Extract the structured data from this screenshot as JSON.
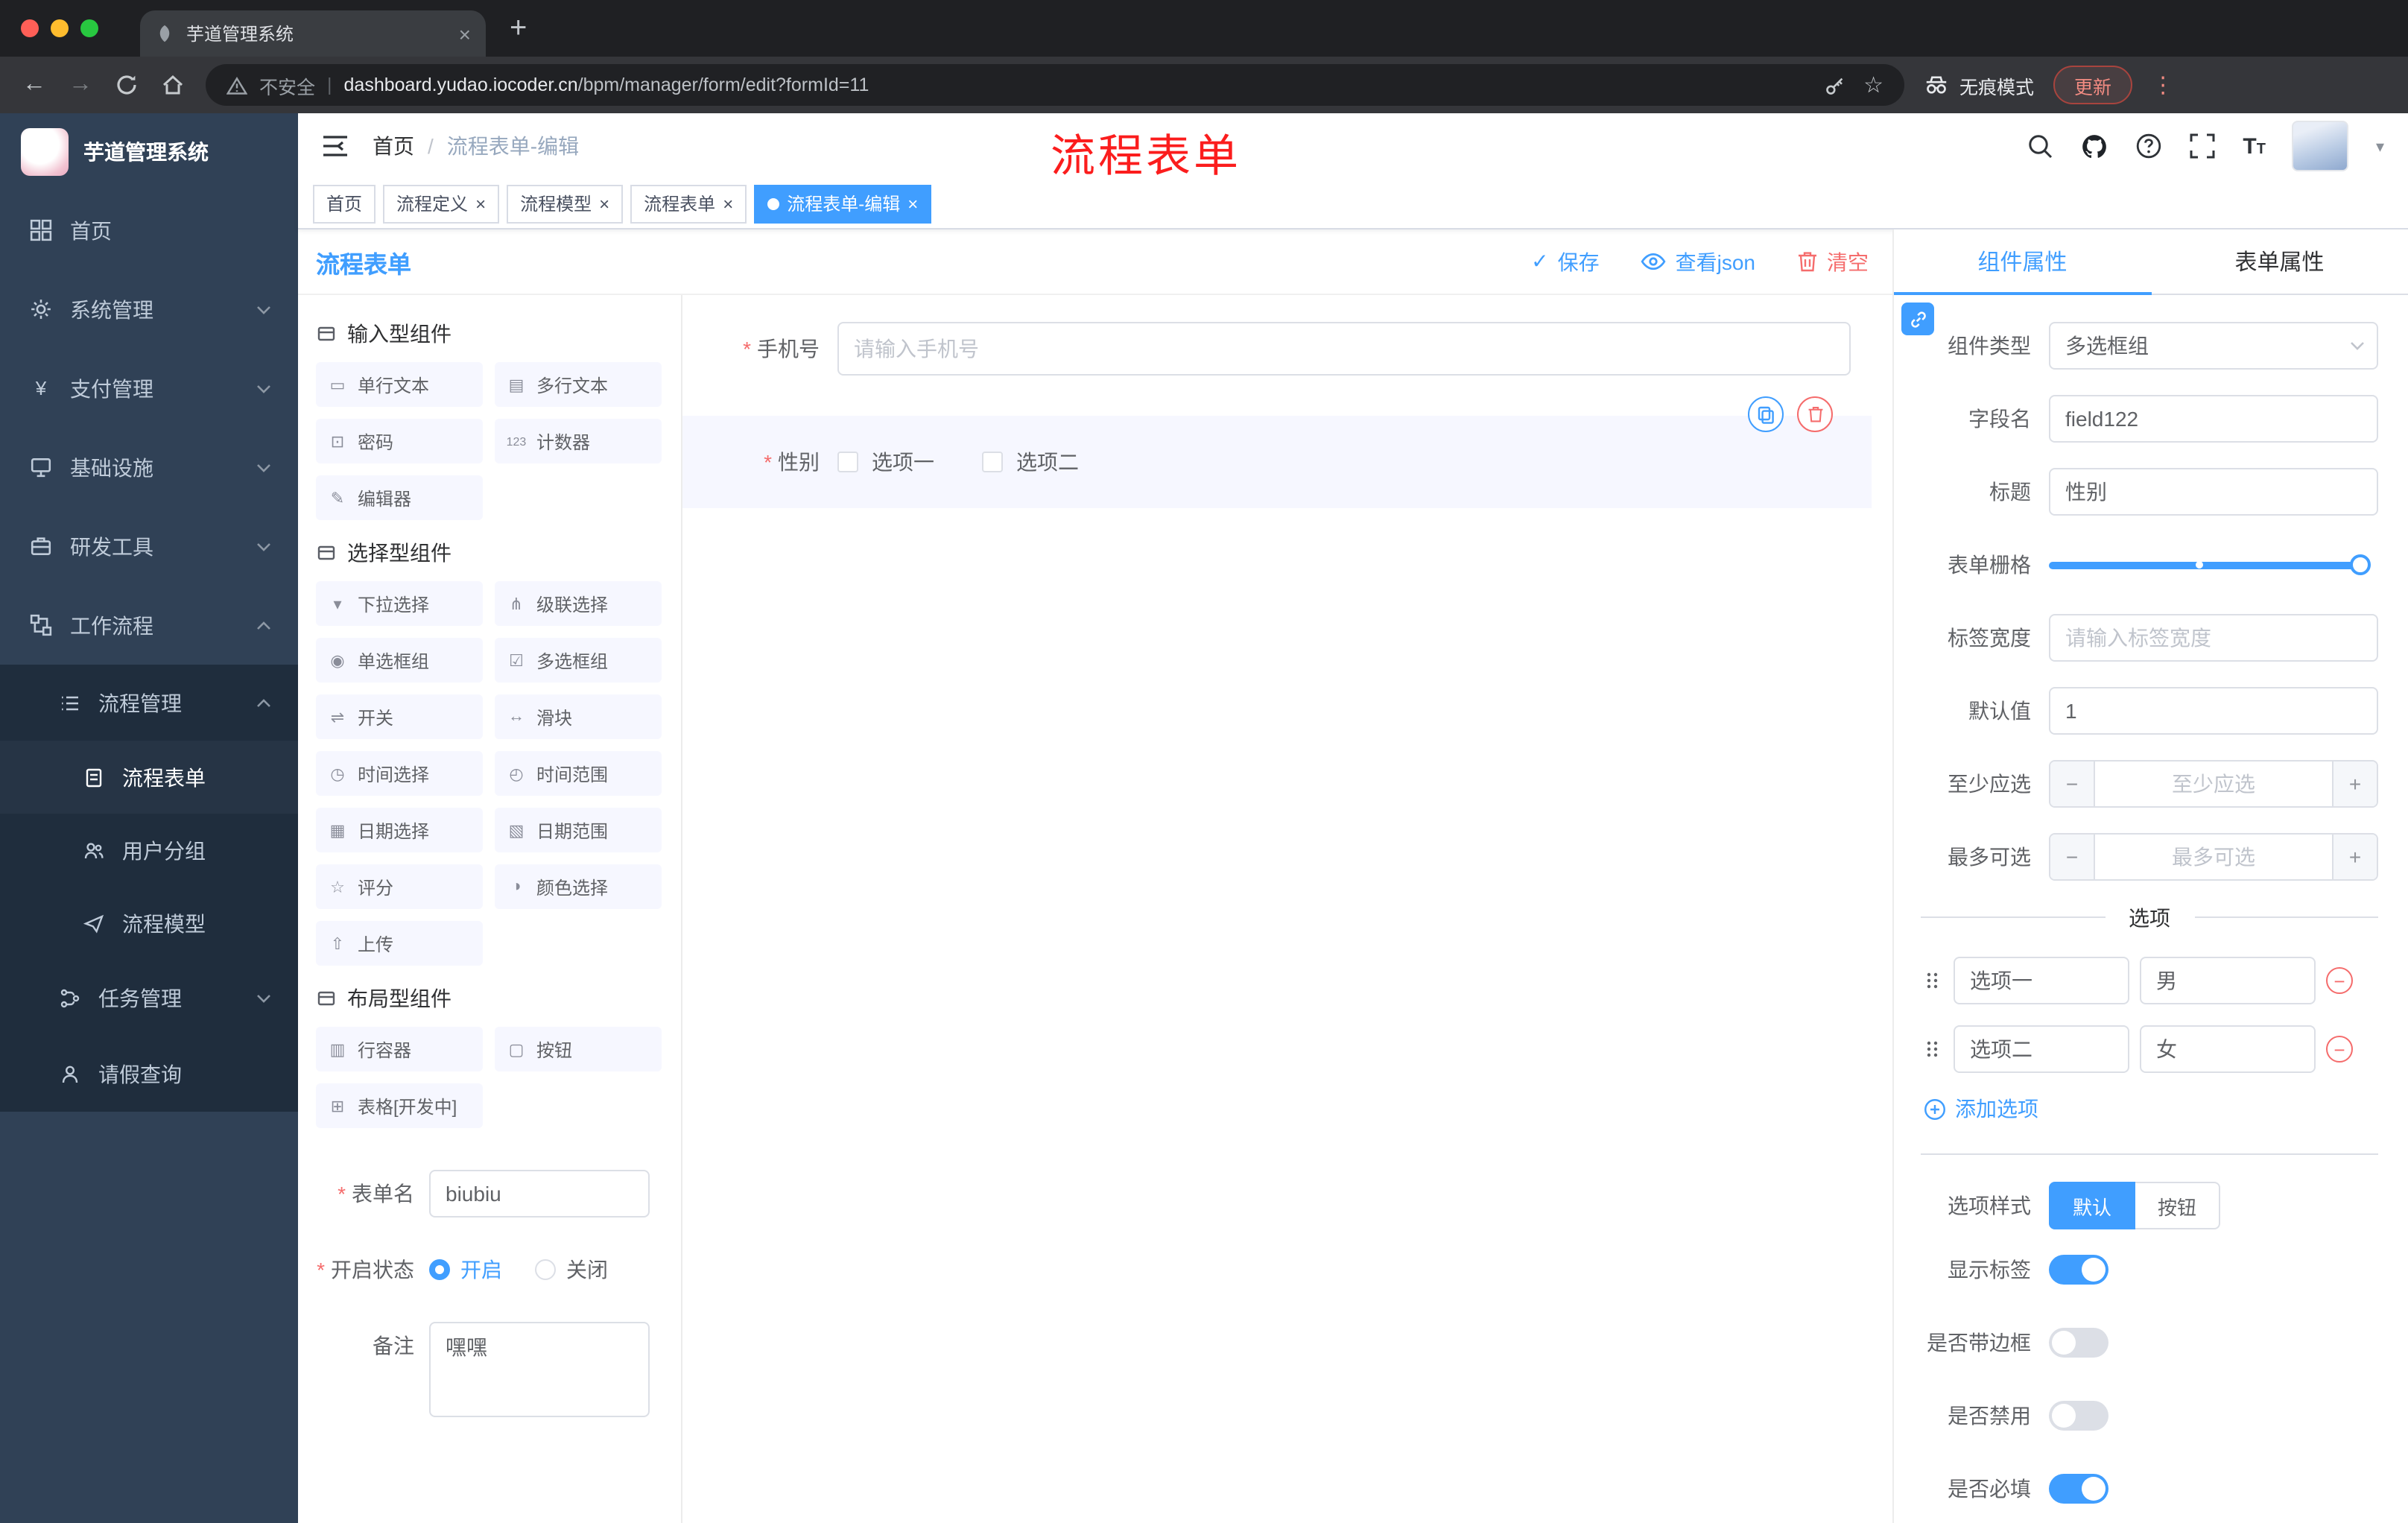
{
  "theme": {
    "accent": "#409eff",
    "danger": "#f56c6c",
    "sidebar_bg": "#304156",
    "submenu_bg": "#1f2d3d",
    "chrome_bg": "#202124"
  },
  "icons": {
    "close": "×",
    "plus": "+",
    "back": "←",
    "forward": "→",
    "star": "☆",
    "dots": "⋮",
    "question": "?",
    "check": "✓",
    "minus": "−",
    "add_plus": "+",
    "url_divider": "|",
    "breadcrumb_sep": "/",
    "caret": "▾",
    "t_big": "T",
    "t_small": "T"
  },
  "browser": {
    "tab_title": "芋道管理系统",
    "security_label": "不安全",
    "url_host": "dashboard.yudao.iocoder.cn",
    "url_path": "/bpm/manager/form/edit?formId=11",
    "incognito_label": "无痕模式",
    "update_label": "更新"
  },
  "annotation": {
    "text": "流程表单",
    "color": "#fb1d1d"
  },
  "sidebar": {
    "logo_title": "芋道管理系统",
    "menu": [
      {
        "label": "首页"
      },
      {
        "label": "系统管理"
      },
      {
        "label": "支付管理",
        "glyph": "¥"
      },
      {
        "label": "基础设施"
      },
      {
        "label": "研发工具"
      },
      {
        "label": "工作流程"
      }
    ],
    "submenu": [
      {
        "label": "流程管理"
      },
      {
        "label": "流程表单"
      },
      {
        "label": "用户分组"
      },
      {
        "label": "流程模型"
      },
      {
        "label": "任务管理"
      },
      {
        "label": "请假查询"
      }
    ]
  },
  "header": {
    "breadcrumb": [
      "首页",
      "流程表单-编辑"
    ]
  },
  "tags": [
    {
      "label": "首页"
    },
    {
      "label": "流程定义"
    },
    {
      "label": "流程模型"
    },
    {
      "label": "流程表单"
    },
    {
      "label": "流程表单-编辑"
    }
  ],
  "designer": {
    "title": "流程表单",
    "actions": {
      "save": "保存",
      "view_json": "查看json",
      "clear": "清空"
    },
    "palette": {
      "sections": [
        {
          "title": "输入型组件",
          "items": [
            {
              "label": "单行文本",
              "glyph": "▭"
            },
            {
              "label": "多行文本",
              "glyph": "▤"
            },
            {
              "label": "密码",
              "glyph": "⊡"
            },
            {
              "label": "计数器",
              "glyph": "123"
            },
            {
              "label": "编辑器",
              "glyph": "✎"
            }
          ]
        },
        {
          "title": "选择型组件",
          "items": [
            {
              "label": "下拉选择",
              "glyph": "▾"
            },
            {
              "label": "级联选择",
              "glyph": "⋔"
            },
            {
              "label": "单选框组",
              "glyph": "◉"
            },
            {
              "label": "多选框组",
              "glyph": "☑"
            },
            {
              "label": "开关",
              "glyph": "⇌"
            },
            {
              "label": "滑块",
              "glyph": "↔"
            },
            {
              "label": "时间选择",
              "glyph": "◷"
            },
            {
              "label": "时间范围",
              "glyph": "◴"
            },
            {
              "label": "日期选择",
              "glyph": "▦"
            },
            {
              "label": "日期范围",
              "glyph": "▧"
            },
            {
              "label": "评分",
              "glyph": "☆"
            },
            {
              "label": "颜色选择",
              "glyph": "◑"
            },
            {
              "label": "上传",
              "glyph": "⇧"
            }
          ]
        },
        {
          "title": "布局型组件",
          "items": [
            {
              "label": "行容器",
              "glyph": "▥"
            },
            {
              "label": "按钮",
              "glyph": "▢"
            },
            {
              "label": "表格[开发中]",
              "glyph": "⊞"
            }
          ]
        }
      ]
    },
    "form_meta": {
      "name_label": "表单名",
      "name_value": "biubiu",
      "status_label": "开启状态",
      "status_on": "开启",
      "status_off": "关闭",
      "remark_label": "备注",
      "remark_value": "嘿嘿"
    },
    "canvas": {
      "phone_label": "手机号",
      "phone_placeholder": "请输入手机号",
      "gender_label": "性别",
      "gender_option1": "选项一",
      "gender_option2": "选项二"
    }
  },
  "props": {
    "tab_component": "组件属性",
    "tab_form": "表单属性",
    "component_type_label": "组件类型",
    "component_type_value": "多选框组",
    "field_name_label": "字段名",
    "field_name_value": "field122",
    "title_label": "标题",
    "title_value": "性别",
    "grid_label": "表单栅格",
    "label_width_label": "标签宽度",
    "label_width_placeholder": "请输入标签宽度",
    "default_label": "默认值",
    "default_value": "1",
    "min_label": "至少应选",
    "min_placeholder": "至少应选",
    "max_label": "最多可选",
    "max_placeholder": "最多可选",
    "options_divider": "选项",
    "options": [
      {
        "label": "选项一",
        "value": "男"
      },
      {
        "label": "选项二",
        "value": "女"
      }
    ],
    "add_option": "添加选项",
    "style_label": "选项样式",
    "style_default": "默认",
    "style_button": "按钮",
    "switch_show_label": "显示标签",
    "switch_border": "是否带边框",
    "switch_disabled": "是否禁用",
    "switch_required": "是否必填"
  }
}
